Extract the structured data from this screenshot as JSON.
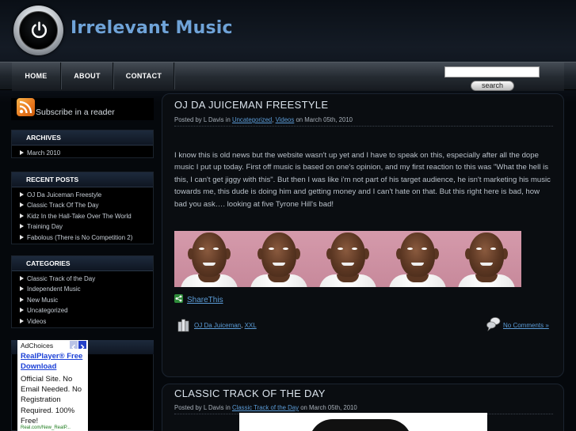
{
  "site": {
    "title": "Irrelevant Music"
  },
  "nav": {
    "items": [
      {
        "label": "HOME"
      },
      {
        "label": "ABOUT"
      },
      {
        "label": "CONTACT"
      }
    ]
  },
  "search": {
    "value": "",
    "button_label": "search"
  },
  "sidebar": {
    "rss_label": "Subscribe in a reader",
    "archives": {
      "heading": "ARCHIVES",
      "items": [
        "March 2010"
      ]
    },
    "recent_posts": {
      "heading": "RECENT POSTS",
      "items": [
        "OJ Da Juiceman Freestyle",
        "Classic Track Of The Day",
        "Kidz In the Hall-Take Over The World",
        "Training Day",
        "Fabolous (There is No Competition 2)"
      ]
    },
    "categories": {
      "heading": "CATEGORIES",
      "items": [
        "Classic Track of the Day",
        "Independent Music",
        "New Music",
        "Uncategorized",
        "Videos"
      ]
    },
    "ad": {
      "label": "AdChoices",
      "headline": "RealPlayer® Free Download",
      "body": "Official Site. No Email Needed. No Registration Required. 100% Free!",
      "url": "Real.com/New_RealP..."
    }
  },
  "posts": [
    {
      "title": "OJ DA JUICEMAN FREESTYLE",
      "meta_prefix": "Posted by L Davis in",
      "categories": [
        "Uncategorized",
        "Videos"
      ],
      "meta_date": "on March 05th, 2010",
      "body": "I know this is old news but the website wasn't up yet and I have to speak on this, especially after all the dope music I put up today. First off music is based on one's opinion, and my first reaction to this was \"What the hell is this, I can't get jiggy with this\". But then I was like i'm not part of his target audience, he isn't marketing his music towards me, this dude is doing him and getting money and I can't hate on that. But this right here is bad, how bad you ask…. looking at five Tyrone Hill's bad!",
      "share_label": "ShareThis",
      "tags": [
        "OJ Da Juiceman",
        "XXL"
      ],
      "comments_label": "No Comments »"
    },
    {
      "title": "CLASSIC TRACK OF THE DAY",
      "meta_prefix": "Posted by L Davis in",
      "categories": [
        "Classic Track of the Day"
      ],
      "meta_date": "on March 05th, 2010"
    }
  ],
  "colors": {
    "accent": "#6fa3d8",
    "link": "#5b9bd6",
    "background": "#05080c"
  }
}
